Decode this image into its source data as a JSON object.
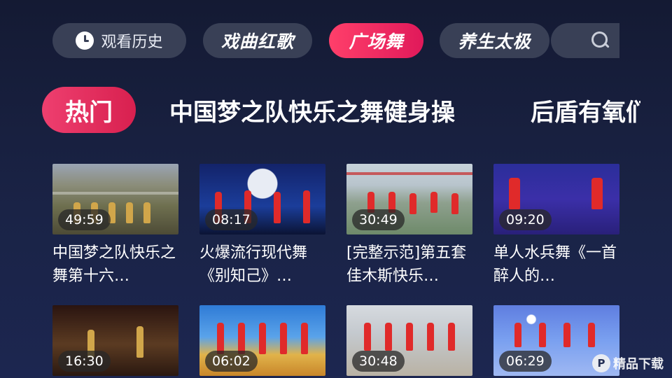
{
  "top_nav": {
    "history_label": "观看历史",
    "history_icon": "clock-icon",
    "categories": [
      {
        "label": "戏曲红歌",
        "active": false
      },
      {
        "label": "广场舞",
        "active": true
      },
      {
        "label": "养生太极",
        "active": false
      }
    ],
    "search_icon": "search-icon"
  },
  "sub_tabs": [
    {
      "label": "热门",
      "active": true
    },
    {
      "label": "中国梦之队快乐之舞健身操",
      "active": false
    },
    {
      "label": "后盾有氧们",
      "active": false
    }
  ],
  "videos": [
    {
      "duration": "49:59",
      "title": "中国梦之队快乐之舞第十六…"
    },
    {
      "duration": "08:17",
      "title": "火爆流行现代舞《别知己》…"
    },
    {
      "duration": "30:49",
      "title": "[完整示范]第五套佳木斯快乐…"
    },
    {
      "duration": "09:20",
      "title": "单人水兵舞《一首醉人的…"
    },
    {
      "duration": "16:30",
      "title": ""
    },
    {
      "duration": "06:02",
      "title": ""
    },
    {
      "duration": "30:48",
      "title": ""
    },
    {
      "duration": "06:29",
      "title": ""
    }
  ],
  "watermark": {
    "badge": "P",
    "text": "精品下载"
  },
  "colors": {
    "background": "#1a2346",
    "pill": "#394056",
    "accent": "#e8285e"
  }
}
